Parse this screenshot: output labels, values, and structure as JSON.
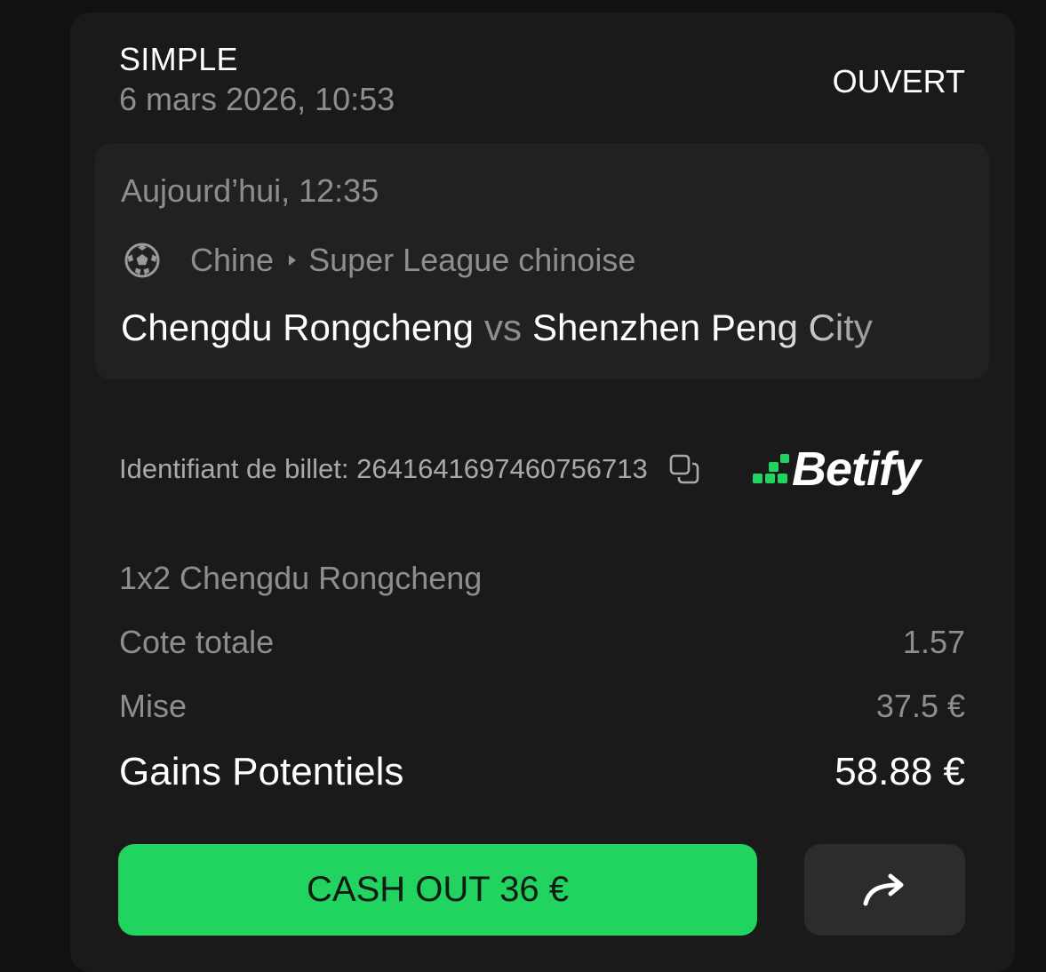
{
  "bet": {
    "type": "SIMPLE",
    "datetime": "6 mars 2026, 10:53",
    "status": "OUVERT"
  },
  "event": {
    "time": "Aujourd’hui, 12:35",
    "sport_icon": "soccer-ball-icon",
    "country": "Chine",
    "league": "Super League chinoise",
    "home_team": "Chengdu Rongcheng",
    "vs": "vs",
    "away_team": "Shenzhen Peng City"
  },
  "ticket": {
    "label": "Identifiant de billet: 2641641697460756713",
    "copy_icon": "copy-icon"
  },
  "brand": {
    "name": "Betify",
    "accent_color": "#21d35f"
  },
  "details": {
    "selection": "1x2 Chengdu Rongcheng",
    "odds_label": "Cote totale",
    "odds_value": "1.57",
    "stake_label": "Mise",
    "stake_value": "37.5 €",
    "gains_label": "Gains Potentiels",
    "gains_value": "58.88 €"
  },
  "actions": {
    "cashout_label": "CASH OUT 36 €",
    "share_icon": "share-arrow-icon"
  }
}
